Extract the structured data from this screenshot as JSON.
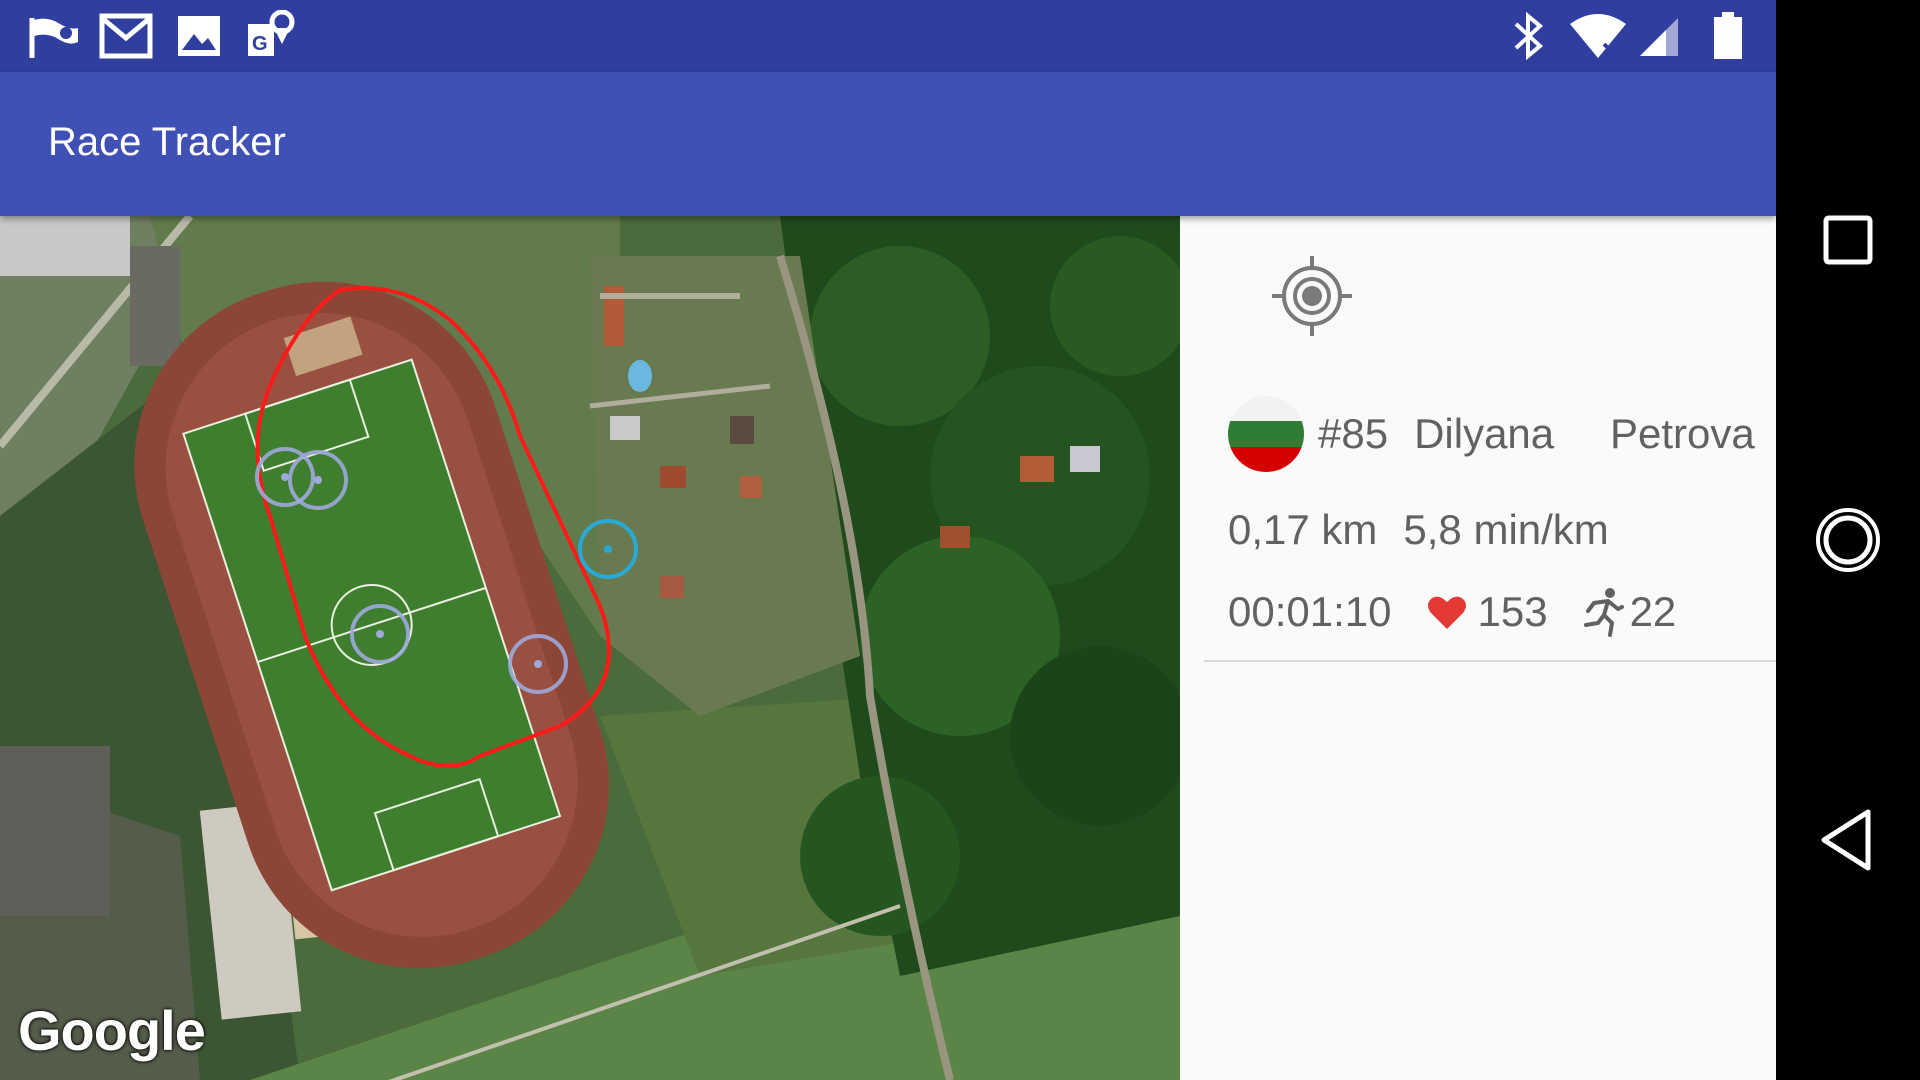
{
  "app": {
    "title": "Race Tracker"
  },
  "status_bar": {
    "left_icons": [
      "windsock-icon",
      "gmail-icon",
      "image-icon",
      "maps-icon"
    ],
    "right_icons": [
      "bluetooth-icon",
      "wifi-icon",
      "signal-icon",
      "battery-icon"
    ]
  },
  "map": {
    "attribution": "Google"
  },
  "runner": {
    "flag_colors": [
      "#f2f2f2",
      "#2e7d32",
      "#d50000"
    ],
    "bib": "#85",
    "first_name": "Dilyana",
    "last_name": "Petrova",
    "distance": "0,17 km",
    "pace": "5,8 min/km",
    "elapsed": "00:01:10",
    "heart_rate": "153",
    "cadence": "22"
  },
  "colors": {
    "status_bar": "#303F9F",
    "app_bar": "#3F51B5",
    "route": "#ff1a1a",
    "marker_other": "#9fa8da",
    "marker_selected": "#29a9d6",
    "heart": "#e53935"
  },
  "nav": {
    "buttons": [
      "recents-button",
      "home-button",
      "back-button"
    ]
  }
}
